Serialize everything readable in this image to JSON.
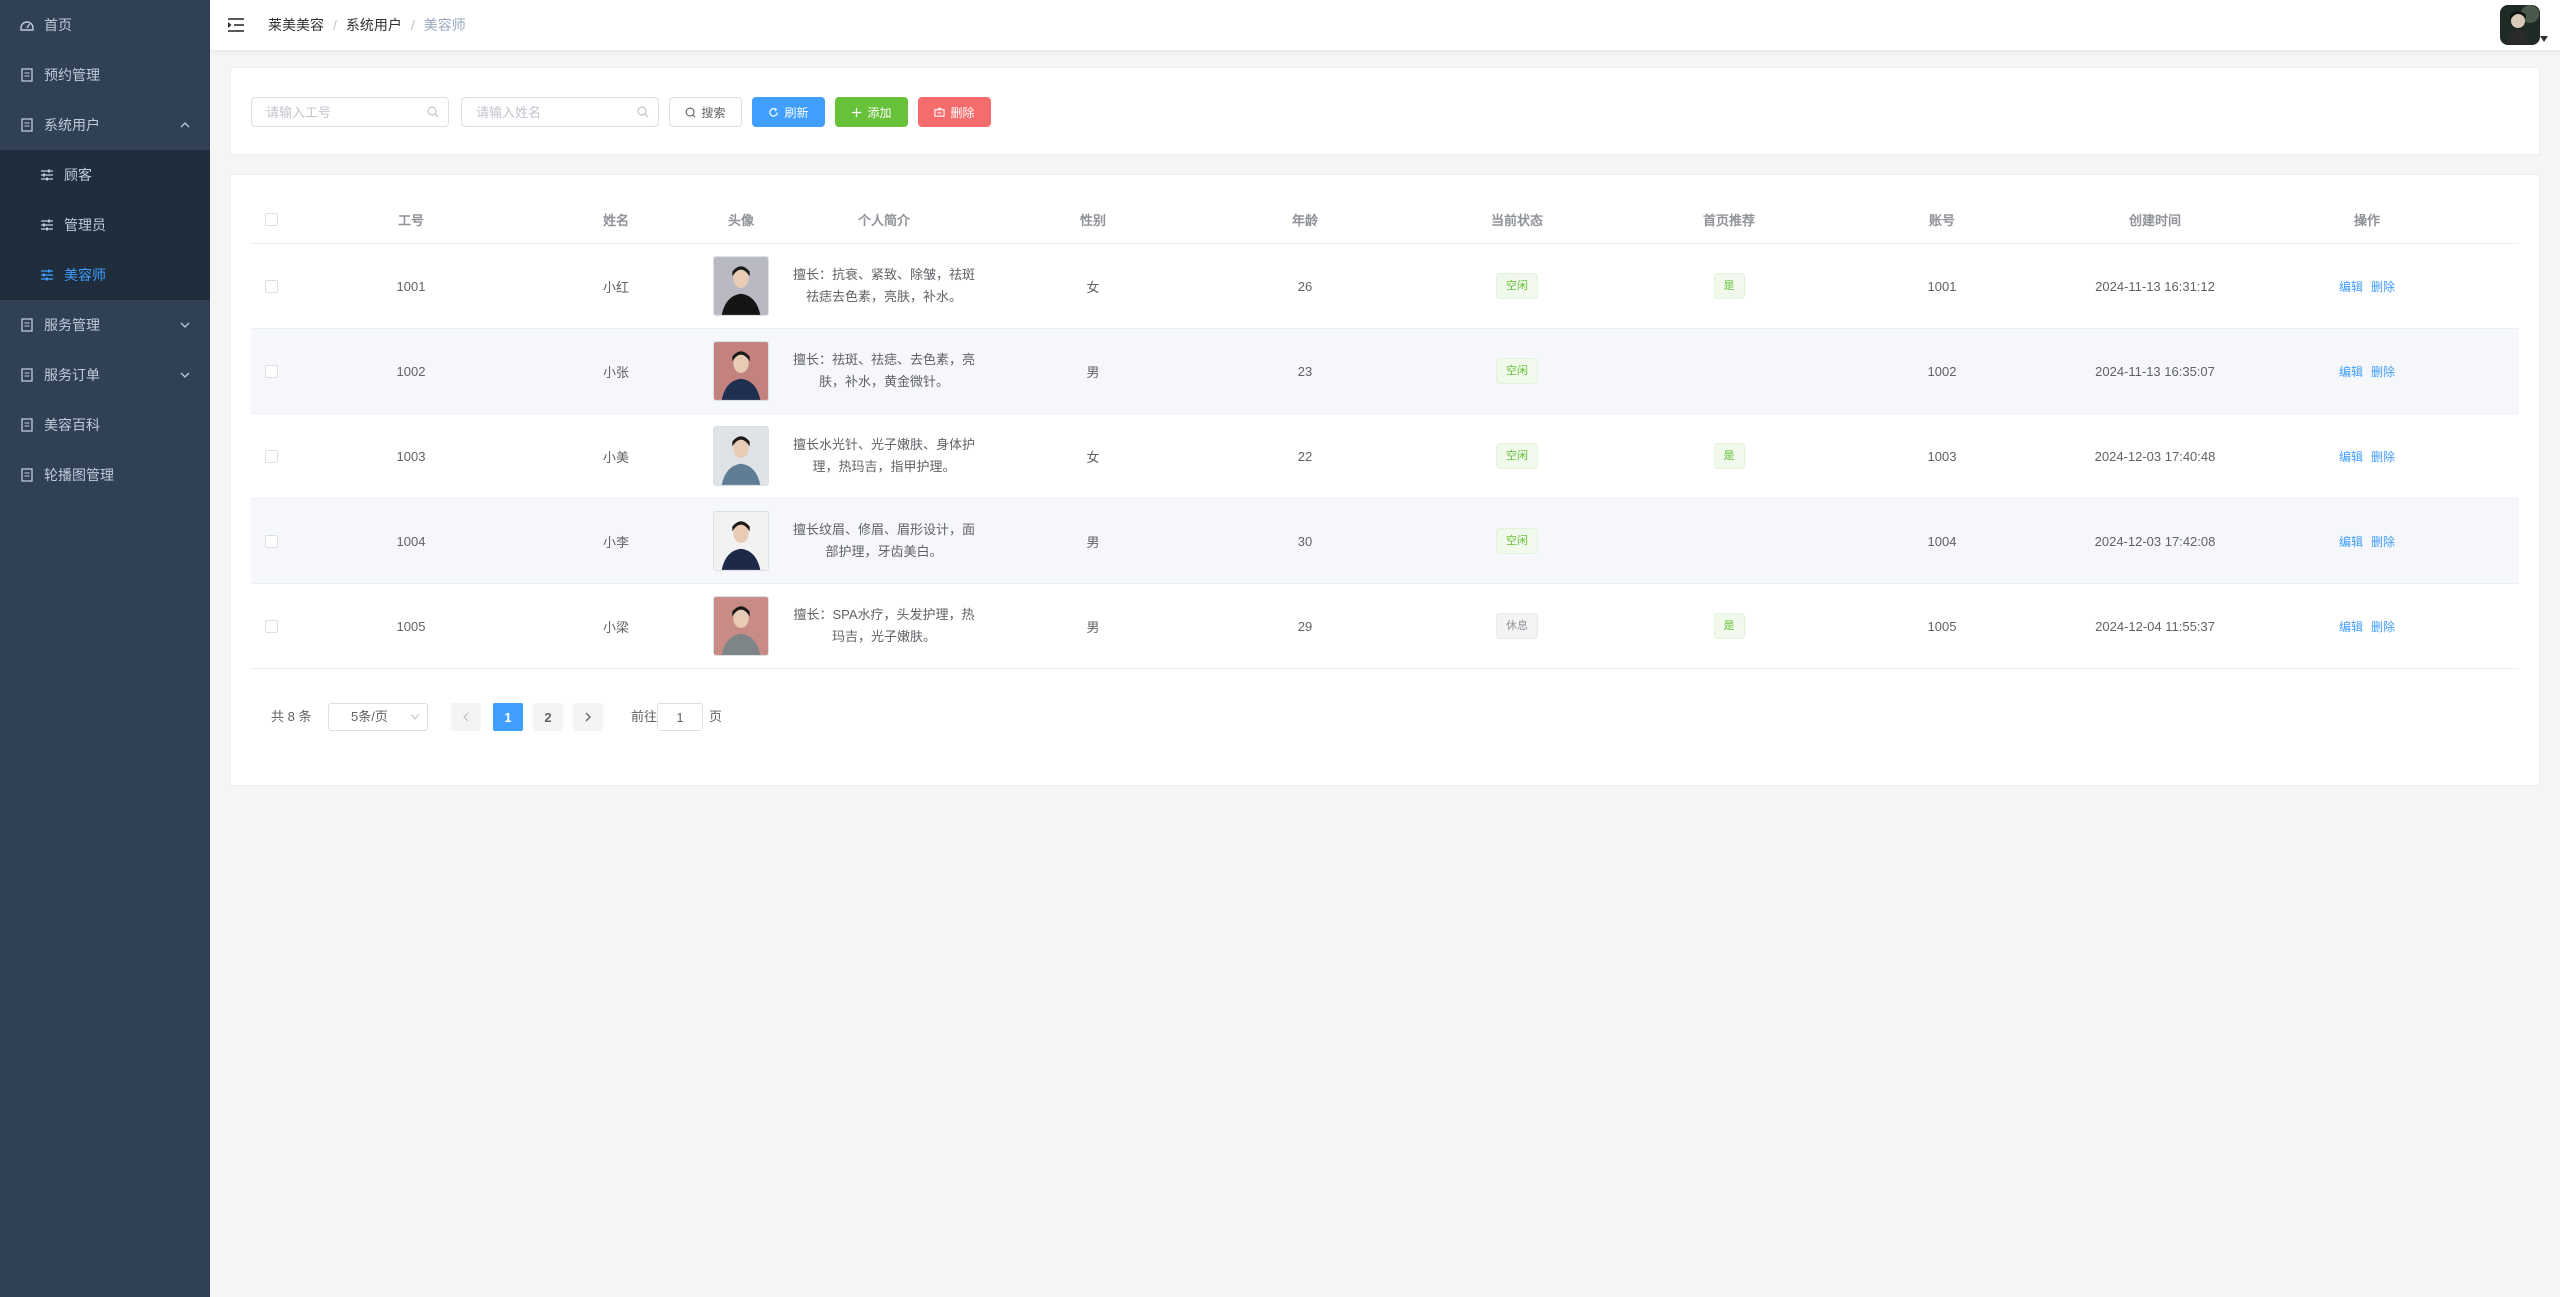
{
  "sidebar": {
    "items": [
      {
        "label": "首页",
        "icon": "dashboard-icon"
      },
      {
        "label": "预约管理",
        "icon": "document-icon"
      },
      {
        "label": "系统用户",
        "icon": "document-icon",
        "expanded": true,
        "children": [
          {
            "label": "顾客",
            "icon": "sliders-icon"
          },
          {
            "label": "管理员",
            "icon": "sliders-icon"
          },
          {
            "label": "美容师",
            "icon": "sliders-icon",
            "active": true
          }
        ]
      },
      {
        "label": "服务管理",
        "icon": "document-icon",
        "expanded": false
      },
      {
        "label": "服务订单",
        "icon": "document-icon",
        "expanded": false
      },
      {
        "label": "美容百科",
        "icon": "document-icon"
      },
      {
        "label": "轮播图管理",
        "icon": "document-icon"
      }
    ]
  },
  "breadcrumb": [
    "莱美美容",
    "系统用户",
    "美容师"
  ],
  "search": {
    "job_no_placeholder": "请输入工号",
    "name_placeholder": "请输入姓名",
    "search_label": "搜索",
    "refresh_label": "刷新",
    "add_label": "添加",
    "delete_label": "删除"
  },
  "table": {
    "columns": [
      "工号",
      "姓名",
      "头像",
      "个人简介",
      "性别",
      "年龄",
      "当前状态",
      "首页推荐",
      "账号",
      "创建时间",
      "操作"
    ],
    "rows": [
      {
        "job_no": "1001",
        "name": "小红",
        "intro": "擅长：抗衰、紧致、除皱，祛斑祛痣去色素，亮肤，补水。",
        "gender": "女",
        "age": "26",
        "status": "空闲",
        "status_type": "success",
        "recommend": "是",
        "account": "1001",
        "created": "2024-11-13 16:31:12",
        "edit": "编辑",
        "delete": "删除",
        "photo_bg": "#b8b9c2",
        "photo_shirt": "#141414"
      },
      {
        "job_no": "1002",
        "name": "小张",
        "intro": "擅长：祛斑、祛痣、去色素，亮肤，补水，黄金微针。",
        "gender": "男",
        "age": "23",
        "status": "空闲",
        "status_type": "success",
        "recommend": "",
        "account": "1002",
        "created": "2024-11-13 16:35:07",
        "edit": "编辑",
        "delete": "删除",
        "photo_bg": "#c4827e",
        "photo_shirt": "#1f2f4f"
      },
      {
        "job_no": "1003",
        "name": "小美",
        "intro": "擅长水光针、光子嫩肤、身体护理，热玛吉，指甲护理。",
        "gender": "女",
        "age": "22",
        "status": "空闲",
        "status_type": "success",
        "recommend": "是",
        "account": "1003",
        "created": "2024-12-03 17:40:48",
        "edit": "编辑",
        "delete": "删除",
        "photo_bg": "#dfe2e6",
        "photo_shirt": "#5f7d94"
      },
      {
        "job_no": "1004",
        "name": "小李",
        "intro": "擅长纹眉、修眉、眉形设计，面部护理，牙齿美白。",
        "gender": "男",
        "age": "30",
        "status": "空闲",
        "status_type": "success",
        "recommend": "",
        "account": "1004",
        "created": "2024-12-03 17:42:08",
        "edit": "编辑",
        "delete": "删除",
        "photo_bg": "#f2f2f2",
        "photo_shirt": "#1c2a48"
      },
      {
        "job_no": "1005",
        "name": "小梁",
        "intro": "擅长：SPA水疗，头发护理，热玛吉，光子嫩肤。",
        "gender": "男",
        "age": "29",
        "status": "休息",
        "status_type": "info",
        "recommend": "是",
        "account": "1005",
        "created": "2024-12-04 11:55:37",
        "edit": "编辑",
        "delete": "删除",
        "photo_bg": "#c98b86",
        "photo_shirt": "#7e8588"
      }
    ]
  },
  "pagination": {
    "total_text": "共 8 条",
    "page_size": "5条/页",
    "pages": [
      "1",
      "2"
    ],
    "current": "1",
    "goto_label": "前往",
    "goto_value": "1",
    "page_suffix": "页"
  },
  "colors": {
    "primary": "#409eff",
    "success": "#67c23a",
    "danger": "#f56c6c",
    "sidebar": "#304156"
  }
}
